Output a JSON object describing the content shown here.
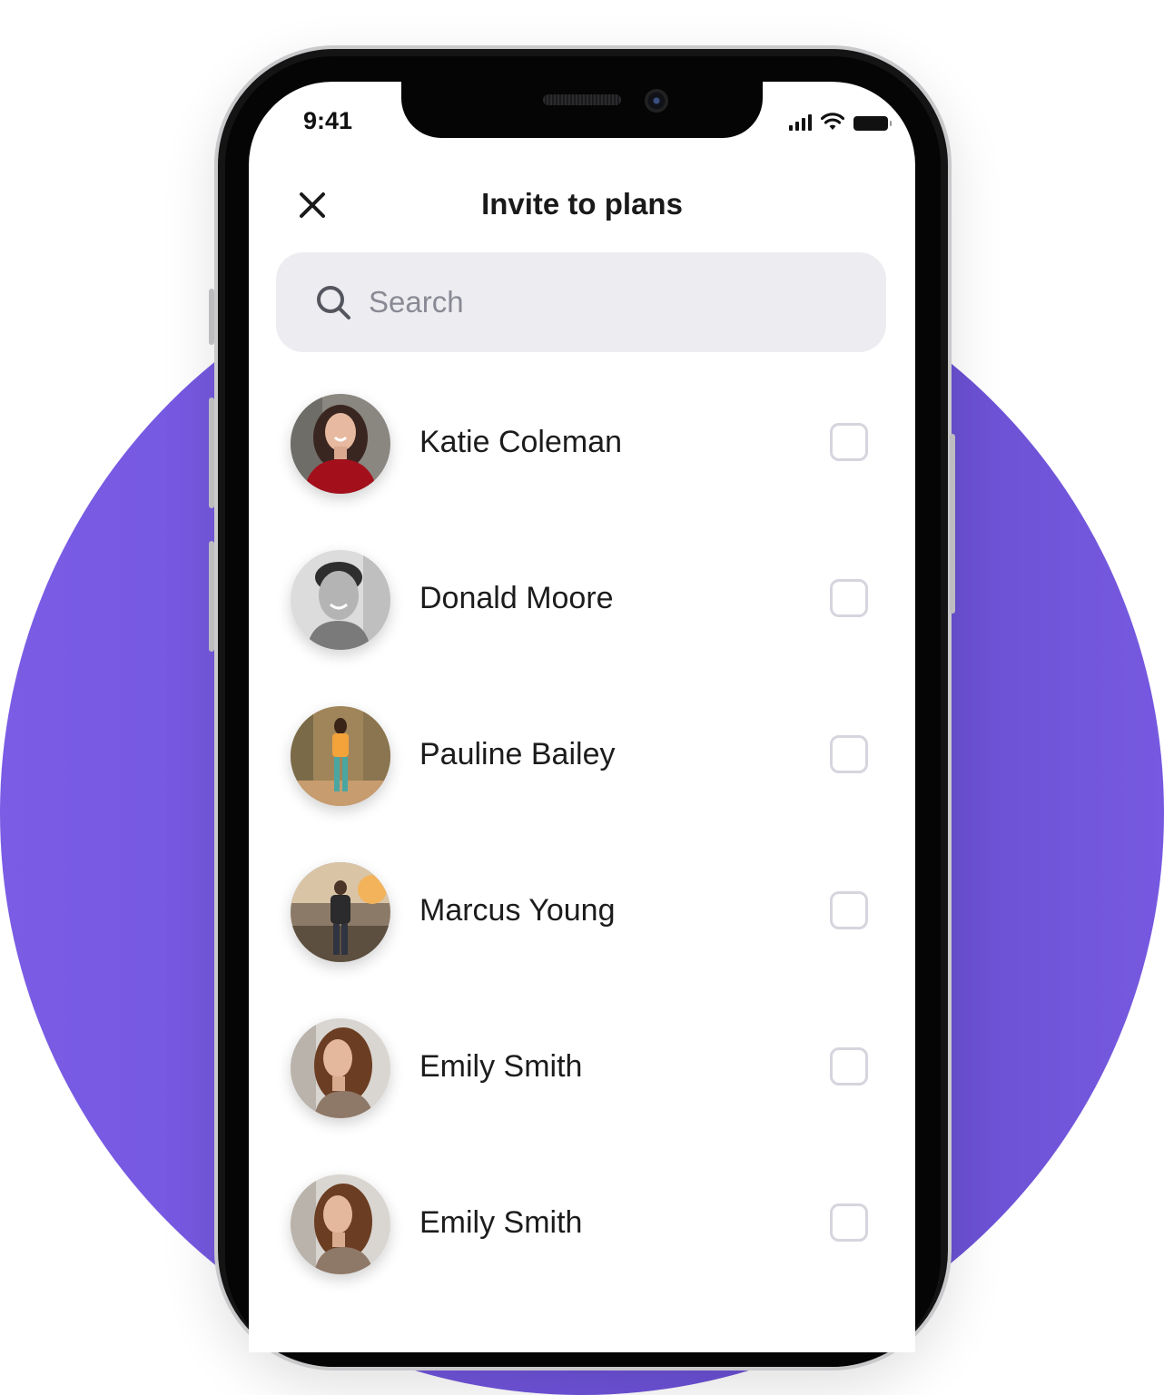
{
  "status_bar": {
    "time": "9:41"
  },
  "header": {
    "title": "Invite to plans",
    "close_icon": "close-icon"
  },
  "search": {
    "placeholder": "Search",
    "icon": "search-icon"
  },
  "contacts": [
    {
      "name": "Katie Coleman"
    },
    {
      "name": "Donald Moore"
    },
    {
      "name": "Pauline Bailey"
    },
    {
      "name": "Marcus Young"
    },
    {
      "name": "Emily Smith"
    },
    {
      "name": "Emily Smith"
    }
  ],
  "colors": {
    "accent_purple": "#7a5ce5",
    "search_bg": "#ededf1",
    "checkbox_border": "#d5d5de"
  }
}
